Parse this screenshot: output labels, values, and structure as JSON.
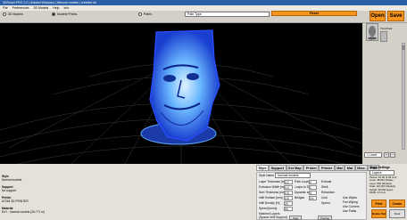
{
  "window": {
    "title": "3DSmart PRO 2.0 | Aldabel Windows | Mimosa models | creative.stl"
  },
  "menu": [
    "File",
    "Preferences",
    "3D Models",
    "Help",
    "Info"
  ],
  "toolbar": {
    "radio_models": "3D Models",
    "radio_models_paths": "Models+Paths",
    "radio_paths": "Paths",
    "path_select": "Path Type",
    "reset_label": "Reset",
    "open_label": "Open",
    "save_label": "Save"
  },
  "viewport": {
    "accent": "#4aa8ff",
    "background": "#000000"
  },
  "right_panel": {
    "thumb_caption": "Thumbnail",
    "zoom_select": "1 Level",
    "layer_select": "Layer 1",
    "stats": [
      "Pieces: 10.00 (4.09 min)",
      "Lines: 48,000 (Scale)",
      "Layer: 800 (Models)",
      "Total: 110,000 (Models)",
      "Height: 30,000 layers",
      "Width: 0.0 mm"
    ]
  },
  "bottom_left": {
    "style_label": "Style",
    "style_value": "Normal models",
    "support_label": "Support",
    "support_value": "No support",
    "printer_label": "Printer",
    "printer_value": "ATOM 3D PRINTER",
    "material_label": "Material",
    "material_value": "EnY - Normal models (26.771 m)"
  },
  "tabs": [
    "Style",
    "Support",
    "Ext Map",
    "Printer",
    "Printer",
    "Mat",
    "Mat",
    "Misc.",
    "PBD"
  ],
  "settings": {
    "style_name_label": "Style Name",
    "style_name_value": "Normal models",
    "rows": [
      "Layer Thickness [mm]",
      "Extrusion Width [mm]",
      "Skin Thickness [mm]",
      "Infill Surface [mm]",
      "Infill Density [%]",
      "Speed [mm/s]"
    ],
    "row_values": [
      "0.2",
      "0.4",
      "0.8",
      "0.8",
      "20",
      "50"
    ],
    "mid_labels": [
      "Path Loops",
      "Loops to Scale",
      "Dynamic scale",
      "Bridges"
    ],
    "mid_values": [
      "2",
      "1",
      "3",
      "On"
    ],
    "right_labels": [
      "Extrude",
      "Shell",
      "Retraction",
      "Cool",
      "Speed"
    ],
    "checkboxes": [
      "Use Wipes",
      "Fan Wiping",
      "Use Corners",
      "Use Paths"
    ],
    "bottom_btns": [
      "Fast",
      "Precise"
    ],
    "bottom_row_labels": [
      "Matched Layers",
      "(Spacer Infill Support)"
    ]
  },
  "show_settings": {
    "title": "Show Settings",
    "select": "Layers",
    "btn_print": "Print",
    "btn_center": "Center",
    "btn_delete": "Delete Style",
    "btn_small": "Shell"
  }
}
